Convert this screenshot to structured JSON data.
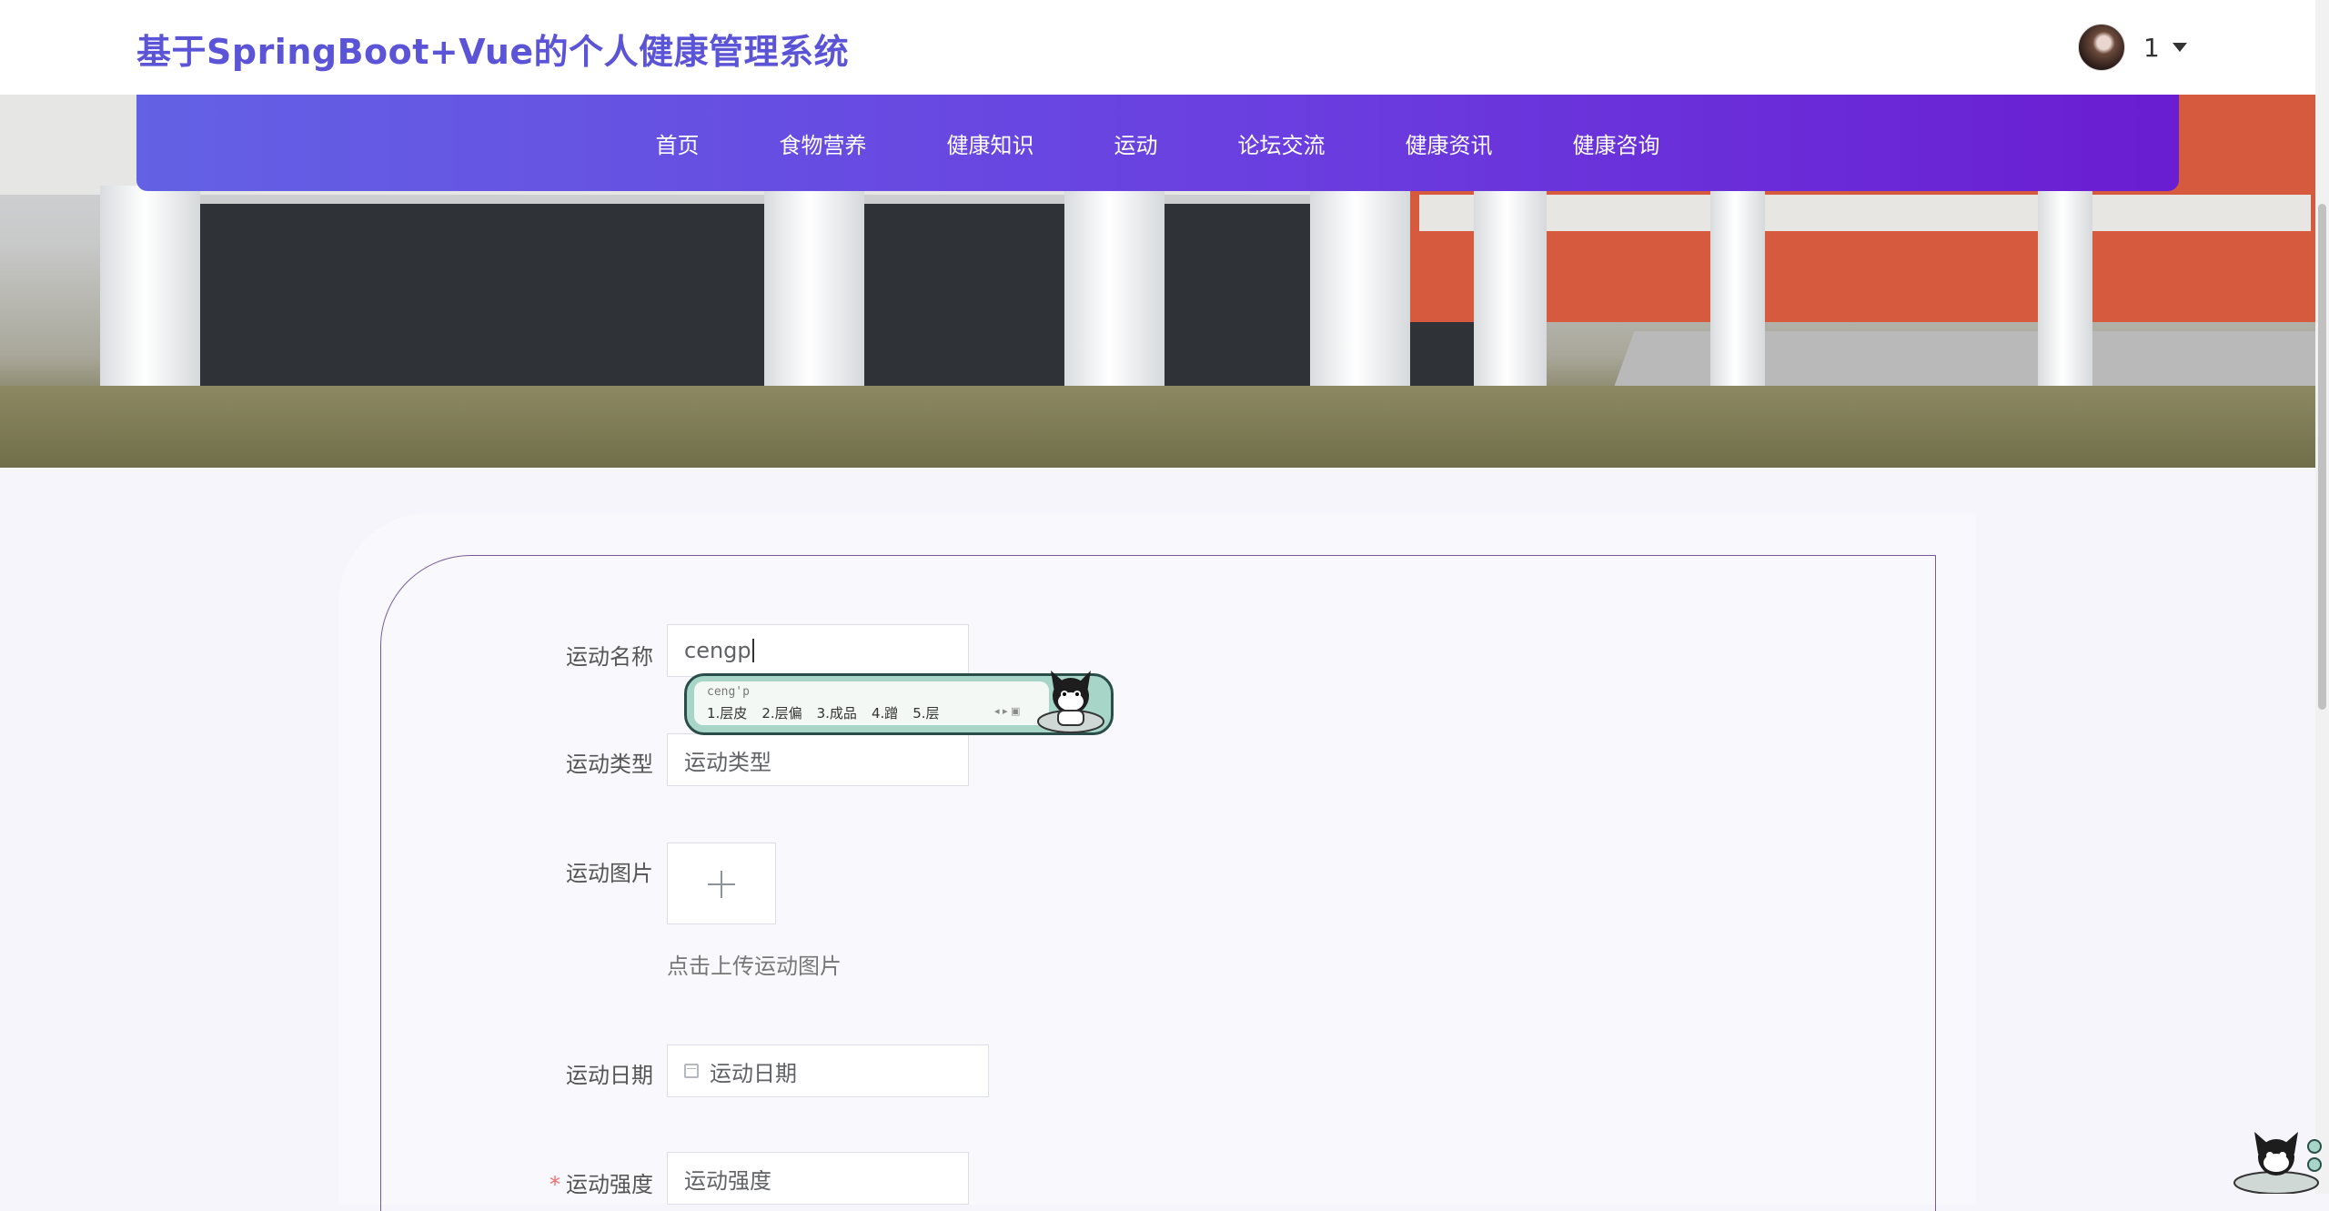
{
  "header": {
    "site_title": "基于SpringBoot+Vue的个人健康管理系统",
    "user_name": "1"
  },
  "nav": {
    "items": [
      "首页",
      "食物营养",
      "健康知识",
      "运动",
      "论坛交流",
      "健康资讯",
      "健康咨询"
    ]
  },
  "carousel": {
    "count": 3,
    "active_index": 0
  },
  "form": {
    "fields": {
      "name_label": "运动名称",
      "name_value": "cengp",
      "type_label": "运动类型",
      "type_placeholder": "运动类型",
      "image_label": "运动图片",
      "image_hint": "点击上传运动图片",
      "date_label": "运动日期",
      "date_placeholder": "运动日期",
      "intensity_label": "运动强度",
      "intensity_placeholder": "运动强度",
      "intensity_required_mark": "*"
    }
  },
  "ime": {
    "composition": "ceng'p",
    "candidates": [
      "1.层皮",
      "2.层偏",
      "3.成品",
      "4.蹭",
      "5.层"
    ]
  },
  "colors": {
    "title": "#5b54d6",
    "nav_start": "#6361e4",
    "nav_end": "#6a1dd1",
    "required": "#f56c6c",
    "card_border": "#7a5a9a"
  }
}
